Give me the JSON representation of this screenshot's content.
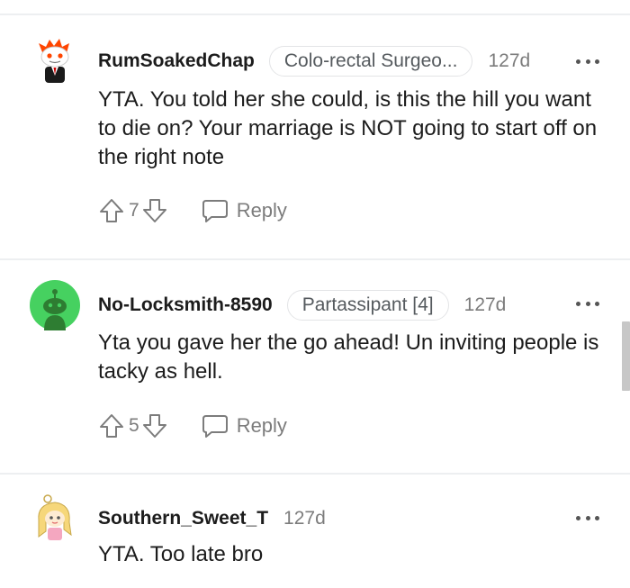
{
  "comments": [
    {
      "username": "RumSoakedChap",
      "flair": "Colo-rectal Surgeo...",
      "age": "127d",
      "text": "YTA. You told her she could, is this the hill you want to die on? Your marriage is NOT going to start off on the right note",
      "score": "7",
      "reply_label": "Reply"
    },
    {
      "username": "No-Locksmith-8590",
      "flair": "Partassipant [4]",
      "age": "127d",
      "text": "Yta you gave her the go ahead! Un inviting people is tacky as hell.",
      "score": "5",
      "reply_label": "Reply"
    },
    {
      "username": "Southern_Sweet_T",
      "age": "127d",
      "text": "YTA. Too late bro"
    }
  ],
  "colors": {
    "divider": "#edeff1",
    "meta_text": "#7c7c7c",
    "avatar_green": "#46d160"
  },
  "icons": [
    "upvote-arrow-icon",
    "downvote-arrow-icon",
    "speech-bubble-icon",
    "more-options-icon"
  ]
}
